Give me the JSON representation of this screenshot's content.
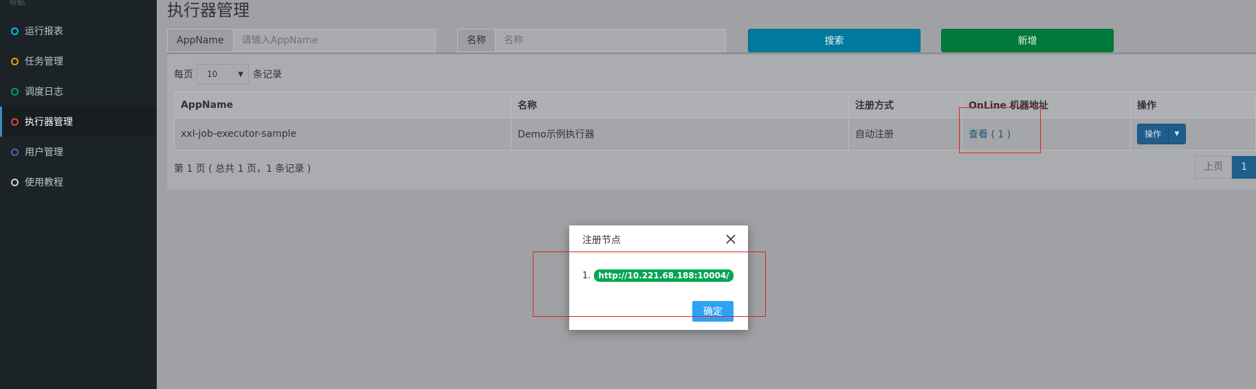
{
  "sidebar": {
    "header": "导航",
    "items": [
      {
        "label": "运行报表",
        "color": "#00c0ef"
      },
      {
        "label": "任务管理",
        "color": "#f39c12"
      },
      {
        "label": "调度日志",
        "color": "#00a65a"
      },
      {
        "label": "执行器管理",
        "color": "#dd4b39"
      },
      {
        "label": "用户管理",
        "color": "#605ca8"
      },
      {
        "label": "使用教程",
        "color": "#d2d6de"
      }
    ],
    "active_index": 3
  },
  "page_title": "执行器管理",
  "filters": {
    "appname_label": "AppName",
    "appname_placeholder": "请输入AppName",
    "name_label": "名称",
    "name_placeholder": "名称"
  },
  "buttons": {
    "search": "搜索",
    "add": "新增"
  },
  "length_menu": {
    "prefix": "每页",
    "value": "10",
    "suffix": "条记录"
  },
  "table": {
    "headers": [
      "AppName",
      "名称",
      "注册方式",
      "OnLine 机器地址",
      "操作"
    ],
    "rows": [
      {
        "appname": "xxl-job-executor-sample",
        "name": "Demo示例执行器",
        "reg_type": "自动注册",
        "online_link": "查看 ( 1 )",
        "op": "操作"
      }
    ]
  },
  "table_info": "第 1 页 ( 总共 1 页，1 条记录 )",
  "pagination": {
    "prev": "上页",
    "current": "1"
  },
  "modal": {
    "title": "注册节点",
    "list_index": "1.",
    "address": "http://10.221.68.188:10004/",
    "ok": "确定"
  }
}
